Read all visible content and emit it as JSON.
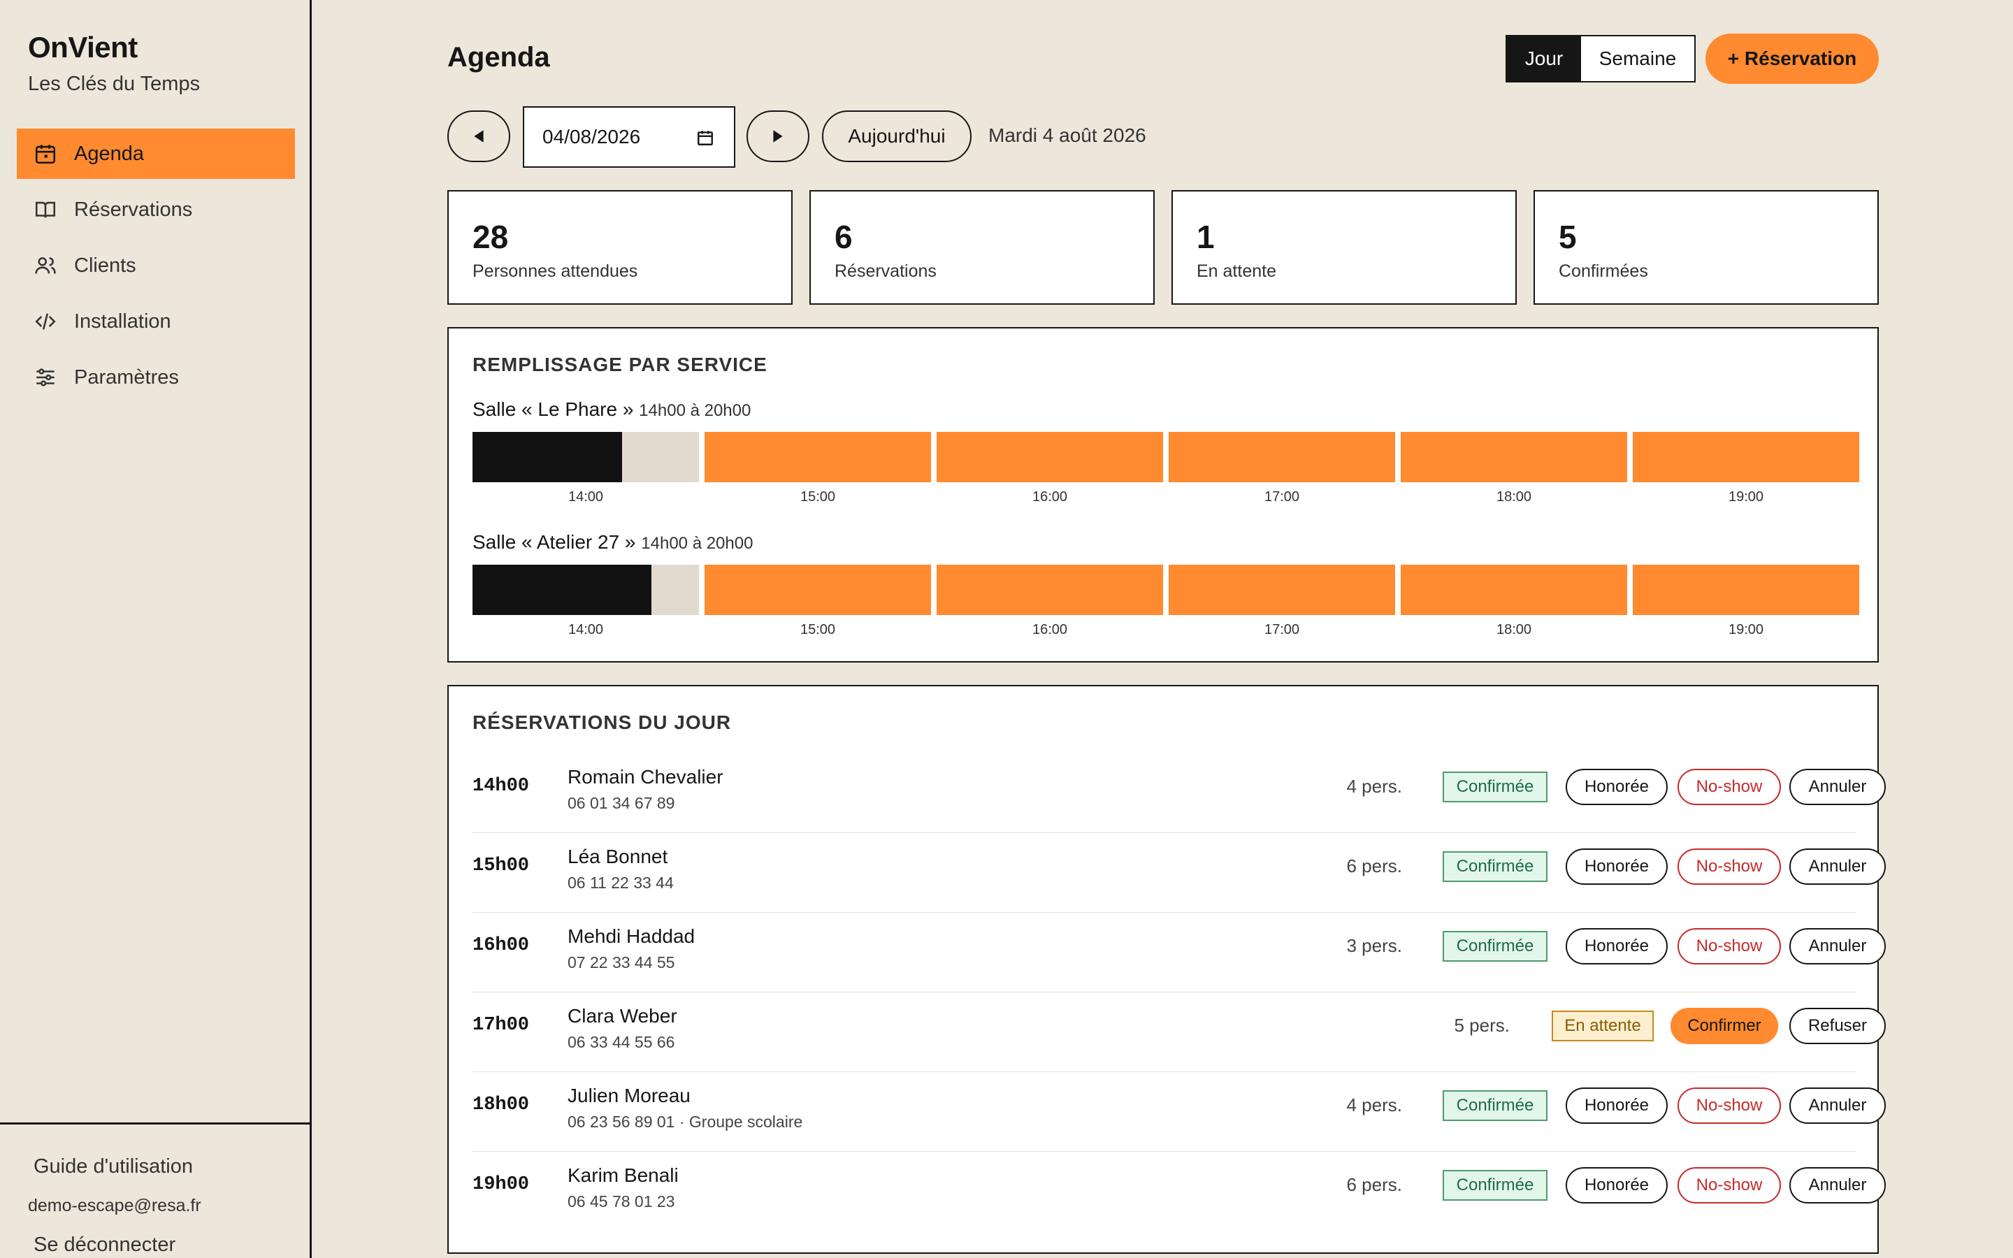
{
  "sidebar": {
    "brand": "OnVient",
    "subtitle": "Les Clés du Temps",
    "items": [
      {
        "label": "Agenda",
        "icon": "calendar-icon",
        "active": true
      },
      {
        "label": "Réservations",
        "icon": "book-icon"
      },
      {
        "label": "Clients",
        "icon": "users-icon"
      },
      {
        "label": "Installation",
        "icon": "code-icon"
      },
      {
        "label": "Paramètres",
        "icon": "sliders-icon"
      }
    ],
    "guide": "Guide d'utilisation",
    "email": "demo-escape@resa.fr",
    "logout": "Se déconnecter"
  },
  "header": {
    "title": "Agenda",
    "view_day": "Jour",
    "view_week": "Semaine",
    "new_reservation": "+ Réservation"
  },
  "datebar": {
    "date_value": "04/08/2026",
    "today": "Aujourd'hui",
    "date_label": "Mardi 4 août 2026"
  },
  "stats": [
    {
      "value": "28",
      "label": "Personnes attendues"
    },
    {
      "value": "6",
      "label": "Réservations"
    },
    {
      "value": "1",
      "label": "En attente"
    },
    {
      "value": "5",
      "label": "Confirmées"
    }
  ],
  "fill": {
    "title": "REMPLISSAGE PAR SERVICE",
    "rooms": [
      {
        "name": "Salle « Le Phare »",
        "hours": "14h00 à 20h00",
        "slots": [
          "14:00",
          "15:00",
          "16:00",
          "17:00",
          "18:00",
          "19:00"
        ],
        "first_slot_fill": 0.66
      },
      {
        "name": "Salle « Atelier 27 »",
        "hours": "14h00 à 20h00",
        "slots": [
          "14:00",
          "15:00",
          "16:00",
          "17:00",
          "18:00",
          "19:00"
        ],
        "first_slot_fill": 0.79
      }
    ]
  },
  "reservations": {
    "title": "RÉSERVATIONS DU JOUR",
    "rows": [
      {
        "time": "14h00",
        "name": "Romain Chevalier",
        "phone": "06 01 34 67 89",
        "pers": "4 pers.",
        "status": "Confirmée",
        "actions": [
          "Honorée",
          "No-show",
          "Annuler"
        ]
      },
      {
        "time": "15h00",
        "name": "Léa Bonnet",
        "phone": "06 11 22 33 44",
        "pers": "6 pers.",
        "status": "Confirmée",
        "actions": [
          "Honorée",
          "No-show",
          "Annuler"
        ]
      },
      {
        "time": "16h00",
        "name": "Mehdi Haddad",
        "phone": "07 22 33 44 55",
        "pers": "3 pers.",
        "status": "Confirmée",
        "actions": [
          "Honorée",
          "No-show",
          "Annuler"
        ]
      },
      {
        "time": "17h00",
        "name": "Clara Weber",
        "phone": "06 33 44 55 66",
        "pers": "5 pers.",
        "status": "En attente",
        "actions": [
          "Confirmer",
          "Refuser"
        ]
      },
      {
        "time": "18h00",
        "name": "Julien Moreau",
        "phone": "06 23 56 89 01 · Groupe scolaire",
        "pers": "4 pers.",
        "status": "Confirmée",
        "actions": [
          "Honorée",
          "No-show",
          "Annuler"
        ]
      },
      {
        "time": "19h00",
        "name": "Karim Benali",
        "phone": "06 45 78 01 23",
        "pers": "6 pers.",
        "status": "Confirmée",
        "actions": [
          "Honorée",
          "No-show",
          "Annuler"
        ]
      }
    ]
  },
  "colors": {
    "accent": "#FF8A2F",
    "bg": "#EDE6DA",
    "ink": "#161616"
  }
}
